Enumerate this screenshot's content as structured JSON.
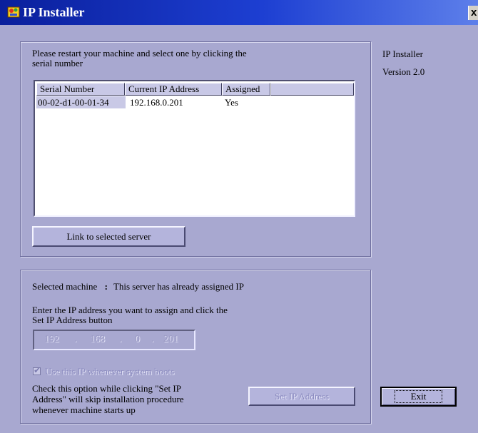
{
  "window": {
    "title": "IP Installer",
    "close_label": "x",
    "icon": "app-icon"
  },
  "side": {
    "app_name": "IP Installer",
    "version": "Version 2.0"
  },
  "server_panel": {
    "instruction": "Please restart your machine and select one by clicking the serial number",
    "instruction_line1": "Please restart your machine and select one by clicking the",
    "instruction_line2": "serial number",
    "columns": [
      "Serial Number",
      "Current IP Address",
      "Assigned"
    ],
    "rows": [
      {
        "serial": "00-02-d1-00-01-34",
        "ip": "192.168.0.201",
        "assigned": "Yes"
      }
    ],
    "link_button": "Link to selected server"
  },
  "assign_panel": {
    "selected_label": "Selected machine",
    "selected_sep": ":",
    "selected_status": "This server has already assigned IP",
    "enter_line1": "Enter the IP address you want to assign and click the",
    "enter_line2": "Set IP Address button",
    "ip_octets": [
      "192",
      "168",
      "0",
      "201"
    ],
    "use_ip_checked": true,
    "use_ip_label": "Use this IP whenever system boots",
    "note_line1": "Check this option while clicking \"Set IP",
    "note_line2": "Address\" will skip installation procedure",
    "note_line3": "whenever machine starts up",
    "set_ip_button": "Set IP Address"
  },
  "exit_button": "Exit",
  "colors": {
    "title_bar": "#0a1f9c",
    "window_bg": "#a8a8d0",
    "disabled_text": "#8c8cc0"
  }
}
